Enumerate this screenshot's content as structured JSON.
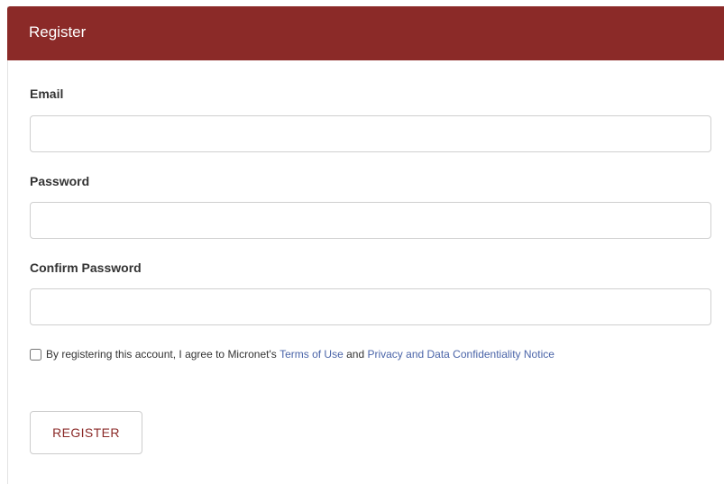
{
  "header": {
    "title": "Register"
  },
  "form": {
    "email": {
      "label": "Email",
      "value": "",
      "placeholder": ""
    },
    "password": {
      "label": "Password",
      "value": "",
      "placeholder": ""
    },
    "confirm_password": {
      "label": "Confirm Password",
      "value": "",
      "placeholder": ""
    },
    "agreement": {
      "checked": false,
      "text_before": "By registering this account, I agree to Micronet's ",
      "terms_link": "Terms of Use",
      "text_middle": " and ",
      "privacy_link": "Privacy and Data Confidentiality Notice"
    },
    "submit_label": "REGISTER"
  },
  "colors": {
    "header_background": "#8b2a28",
    "link": "#4a64a8",
    "button_text": "#8b2a28"
  }
}
